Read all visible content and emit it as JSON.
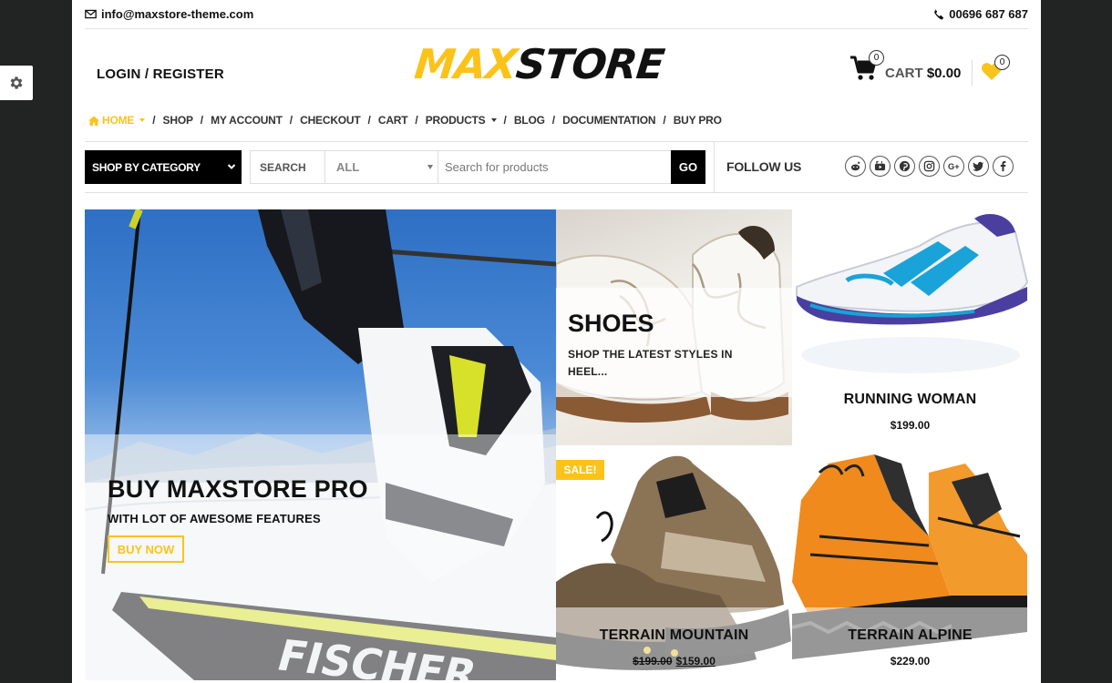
{
  "topbar": {
    "email": "info@maxstore-theme.com",
    "phone": "00696 687 687"
  },
  "header": {
    "login_register": "LOGIN / REGISTER",
    "logo_part1": "MAX",
    "logo_part2": "STORE",
    "cart_label": "CART",
    "cart_amount": "$0.00",
    "cart_count": "0",
    "wishlist_count": "0"
  },
  "nav": {
    "items": [
      {
        "label": "HOME",
        "active": true,
        "dropdown": true
      },
      {
        "label": "SHOP"
      },
      {
        "label": "MY ACCOUNT"
      },
      {
        "label": "CHECKOUT"
      },
      {
        "label": "CART"
      },
      {
        "label": "PRODUCTS",
        "dropdown": true
      },
      {
        "label": "BLOG"
      },
      {
        "label": "DOCUMENTATION"
      },
      {
        "label": "BUY PRO"
      }
    ]
  },
  "search": {
    "category_button": "SHOP BY CATEGORY",
    "label": "SEARCH",
    "category_value": "ALL",
    "placeholder": "Search for products",
    "go": "GO"
  },
  "follow": {
    "label": "FOLLOW US",
    "icons": [
      "reddit-icon",
      "youtube-icon",
      "pinterest-icon",
      "instagram-icon",
      "google-plus-icon",
      "twitter-icon",
      "facebook-icon"
    ]
  },
  "banners": {
    "main": {
      "title": "BUY MAXSTORE PRO",
      "subtitle": "WITH LOT OF AWESOME FEATURES",
      "button": "BUY NOW"
    },
    "shoes": {
      "title": "SHOES",
      "subtitle": "SHOP THE LATEST STYLES IN HEEL..."
    },
    "running": {
      "name": "RUNNING WOMAN",
      "price": "$199.00"
    },
    "mountain": {
      "badge": "SALE!",
      "name": "TERRAIN MOUNTAIN",
      "old_price": "$199.00",
      "new_price": "$159.00"
    },
    "alpine": {
      "name": "TERRAIN ALPINE",
      "price": "$229.00"
    }
  },
  "colors": {
    "accent": "#fbc31a",
    "dark": "#000000",
    "frame": "#222323"
  }
}
